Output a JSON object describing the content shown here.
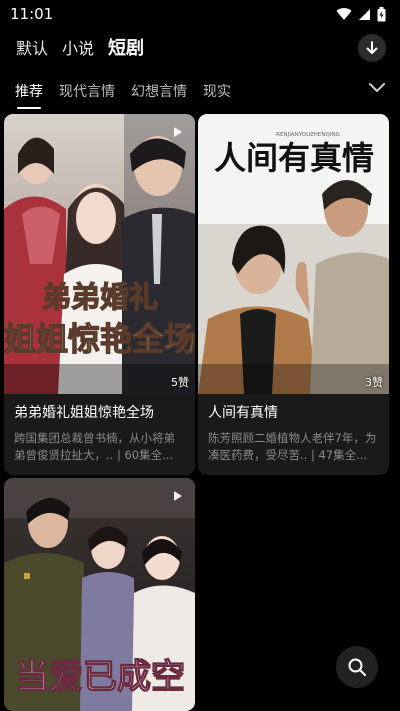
{
  "status": {
    "time": "11:01"
  },
  "topnav": {
    "items": [
      "默认",
      "小说",
      "短剧"
    ],
    "active_index": 2
  },
  "tabs": {
    "items": [
      "推荐",
      "现代言情",
      "幻想言情",
      "现实"
    ],
    "active_index": 0
  },
  "cards": [
    {
      "title": "弟弟婚礼姐姐惊艳全场",
      "desc": "跨国集团总裁曾书楠，从小将弟弟曾俊贤拉扯大，.. | 60集全...",
      "likes": "5赞",
      "poster_text": "弟弟婚礼 姐姐惊艳全场"
    },
    {
      "title": "人间有真情",
      "desc": "陈芳照顾二婚植物人老伴7年，为凑医药费，受尽苦.. | 47集全...",
      "likes": "3赞",
      "poster_text": "人间有真情",
      "poster_subtext": "RENJIANYOUZHENQING"
    },
    {
      "title": "",
      "desc": "",
      "likes": "",
      "poster_text": "当爱已成空"
    }
  ],
  "icons": {
    "download": "download-icon",
    "expand": "chevron-down-icon",
    "search": "search-icon",
    "play": "play-icon"
  }
}
